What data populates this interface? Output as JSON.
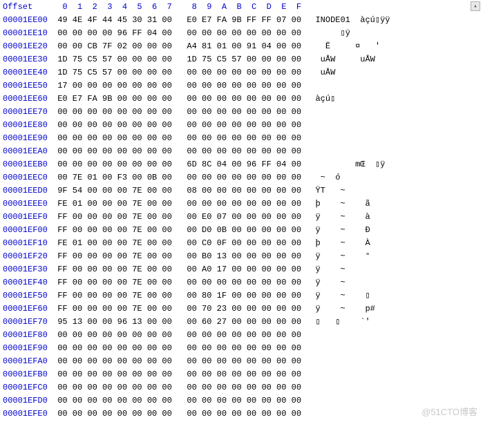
{
  "header": {
    "offset_label": "Offset",
    "columns": [
      "0",
      "1",
      "2",
      "3",
      "4",
      "5",
      "6",
      "7",
      "8",
      "9",
      "A",
      "B",
      "C",
      "D",
      "E",
      "F"
    ]
  },
  "rows": [
    {
      "offset": "00001EE00",
      "hex": [
        "49",
        "4E",
        "4F",
        "44",
        "45",
        "30",
        "31",
        "00",
        "E0",
        "E7",
        "FA",
        "9B",
        "FF",
        "FF",
        "07",
        "00"
      ],
      "ascii": "INODE01  àçú▯ÿÿ"
    },
    {
      "offset": "00001EE10",
      "hex": [
        "00",
        "00",
        "00",
        "00",
        "96",
        "FF",
        "04",
        "00",
        "00",
        "00",
        "00",
        "00",
        "00",
        "00",
        "00",
        "00"
      ],
      "ascii": "     ▯ÿ         "
    },
    {
      "offset": "00001EE20",
      "hex": [
        "00",
        "00",
        "CB",
        "7F",
        "02",
        "00",
        "00",
        "00",
        "A4",
        "81",
        "01",
        "00",
        "91",
        "04",
        "00",
        "00"
      ],
      "ascii": "  Ë     ¤   '   "
    },
    {
      "offset": "00001EE30",
      "hex": [
        "1D",
        "75",
        "C5",
        "57",
        "00",
        "00",
        "00",
        "00",
        "1D",
        "75",
        "C5",
        "57",
        "00",
        "00",
        "00",
        "00"
      ],
      "ascii": " uÅW     uÅW    "
    },
    {
      "offset": "00001EE40",
      "hex": [
        "1D",
        "75",
        "C5",
        "57",
        "00",
        "00",
        "00",
        "00",
        "00",
        "00",
        "00",
        "00",
        "00",
        "00",
        "00",
        "00"
      ],
      "ascii": " uÅW            "
    },
    {
      "offset": "00001EE50",
      "hex": [
        "17",
        "00",
        "00",
        "00",
        "00",
        "00",
        "00",
        "00",
        "00",
        "00",
        "00",
        "00",
        "00",
        "00",
        "00",
        "00"
      ],
      "ascii": "                "
    },
    {
      "offset": "00001EE60",
      "hex": [
        "E0",
        "E7",
        "FA",
        "9B",
        "00",
        "00",
        "00",
        "00",
        "00",
        "00",
        "00",
        "00",
        "00",
        "00",
        "00",
        "00"
      ],
      "ascii": "àçú▯            "
    },
    {
      "offset": "00001EE70",
      "hex": [
        "00",
        "00",
        "00",
        "00",
        "00",
        "00",
        "00",
        "00",
        "00",
        "00",
        "00",
        "00",
        "00",
        "00",
        "00",
        "00"
      ],
      "ascii": "                "
    },
    {
      "offset": "00001EE80",
      "hex": [
        "00",
        "00",
        "00",
        "00",
        "00",
        "00",
        "00",
        "00",
        "00",
        "00",
        "00",
        "00",
        "00",
        "00",
        "00",
        "00"
      ],
      "ascii": "                "
    },
    {
      "offset": "00001EE90",
      "hex": [
        "00",
        "00",
        "00",
        "00",
        "00",
        "00",
        "00",
        "00",
        "00",
        "00",
        "00",
        "00",
        "00",
        "00",
        "00",
        "00"
      ],
      "ascii": "                "
    },
    {
      "offset": "00001EEA0",
      "hex": [
        "00",
        "00",
        "00",
        "00",
        "00",
        "00",
        "00",
        "00",
        "00",
        "00",
        "00",
        "00",
        "00",
        "00",
        "00",
        "00"
      ],
      "ascii": "                "
    },
    {
      "offset": "00001EEB0",
      "hex": [
        "00",
        "00",
        "00",
        "00",
        "00",
        "00",
        "00",
        "00",
        "6D",
        "8C",
        "04",
        "00",
        "96",
        "FF",
        "04",
        "00"
      ],
      "ascii": "        mŒ  ▯ÿ  "
    },
    {
      "offset": "00001EEC0",
      "hex": [
        "00",
        "7E",
        "01",
        "00",
        "F3",
        "00",
        "0B",
        "00",
        "00",
        "00",
        "00",
        "00",
        "00",
        "00",
        "00",
        "00"
      ],
      "ascii": " ~  ó           "
    },
    {
      "offset": "00001EED0",
      "hex": [
        "9F",
        "54",
        "00",
        "00",
        "00",
        "7E",
        "00",
        "00",
        "08",
        "00",
        "00",
        "00",
        "00",
        "00",
        "00",
        "00"
      ],
      "ascii": "ŸT   ~          "
    },
    {
      "offset": "00001EEE0",
      "hex": [
        "FE",
        "01",
        "00",
        "00",
        "00",
        "7E",
        "00",
        "00",
        "00",
        "00",
        "00",
        "00",
        "00",
        "00",
        "00",
        "00"
      ],
      "ascii": "þ    ~    ã     "
    },
    {
      "offset": "00001EEF0",
      "hex": [
        "FF",
        "00",
        "00",
        "00",
        "00",
        "7E",
        "00",
        "00",
        "00",
        "E0",
        "07",
        "00",
        "00",
        "00",
        "00",
        "00"
      ],
      "ascii": "ÿ    ~    à     "
    },
    {
      "offset": "00001EF00",
      "hex": [
        "FF",
        "00",
        "00",
        "00",
        "00",
        "7E",
        "00",
        "00",
        "00",
        "D0",
        "0B",
        "00",
        "00",
        "00",
        "00",
        "00"
      ],
      "ascii": "ÿ    ~    Ð     "
    },
    {
      "offset": "00001EF10",
      "hex": [
        "FE",
        "01",
        "00",
        "00",
        "00",
        "7E",
        "00",
        "00",
        "00",
        "C0",
        "0F",
        "00",
        "00",
        "00",
        "00",
        "00"
      ],
      "ascii": "þ    ~    À     "
    },
    {
      "offset": "00001EF20",
      "hex": [
        "FF",
        "00",
        "00",
        "00",
        "00",
        "7E",
        "00",
        "00",
        "00",
        "B0",
        "13",
        "00",
        "00",
        "00",
        "00",
        "00"
      ],
      "ascii": "ÿ    ~    °     "
    },
    {
      "offset": "00001EF30",
      "hex": [
        "FF",
        "00",
        "00",
        "00",
        "00",
        "7E",
        "00",
        "00",
        "00",
        "A0",
        "17",
        "00",
        "00",
        "00",
        "00",
        "00"
      ],
      "ascii": "ÿ    ~          "
    },
    {
      "offset": "00001EF40",
      "hex": [
        "FF",
        "00",
        "00",
        "00",
        "00",
        "7E",
        "00",
        "00",
        "00",
        "00",
        "00",
        "00",
        "00",
        "00",
        "00",
        "00"
      ],
      "ascii": "ÿ    ~          "
    },
    {
      "offset": "00001EF50",
      "hex": [
        "FF",
        "00",
        "00",
        "00",
        "00",
        "7E",
        "00",
        "00",
        "00",
        "80",
        "1F",
        "00",
        "00",
        "00",
        "00",
        "00"
      ],
      "ascii": "ÿ    ~    ▯     "
    },
    {
      "offset": "00001EF60",
      "hex": [
        "FF",
        "00",
        "00",
        "00",
        "00",
        "7E",
        "00",
        "00",
        "00",
        "70",
        "23",
        "00",
        "00",
        "00",
        "00",
        "00"
      ],
      "ascii": "ÿ    ~    p#    "
    },
    {
      "offset": "00001EF70",
      "hex": [
        "95",
        "13",
        "00",
        "00",
        "96",
        "13",
        "00",
        "00",
        "00",
        "60",
        "27",
        "00",
        "00",
        "00",
        "00",
        "00"
      ],
      "ascii": "▯   ▯    `'     "
    },
    {
      "offset": "00001EF80",
      "hex": [
        "00",
        "00",
        "00",
        "00",
        "00",
        "00",
        "00",
        "00",
        "00",
        "00",
        "00",
        "00",
        "00",
        "00",
        "00",
        "00"
      ],
      "ascii": "                "
    },
    {
      "offset": "00001EF90",
      "hex": [
        "00",
        "00",
        "00",
        "00",
        "00",
        "00",
        "00",
        "00",
        "00",
        "00",
        "00",
        "00",
        "00",
        "00",
        "00",
        "00"
      ],
      "ascii": "                "
    },
    {
      "offset": "00001EFA0",
      "hex": [
        "00",
        "00",
        "00",
        "00",
        "00",
        "00",
        "00",
        "00",
        "00",
        "00",
        "00",
        "00",
        "00",
        "00",
        "00",
        "00"
      ],
      "ascii": "                "
    },
    {
      "offset": "00001EFB0",
      "hex": [
        "00",
        "00",
        "00",
        "00",
        "00",
        "00",
        "00",
        "00",
        "00",
        "00",
        "00",
        "00",
        "00",
        "00",
        "00",
        "00"
      ],
      "ascii": "                "
    },
    {
      "offset": "00001EFC0",
      "hex": [
        "00",
        "00",
        "00",
        "00",
        "00",
        "00",
        "00",
        "00",
        "00",
        "00",
        "00",
        "00",
        "00",
        "00",
        "00",
        "00"
      ],
      "ascii": "                "
    },
    {
      "offset": "00001EFD0",
      "hex": [
        "00",
        "00",
        "00",
        "00",
        "00",
        "00",
        "00",
        "00",
        "00",
        "00",
        "00",
        "00",
        "00",
        "00",
        "00",
        "00"
      ],
      "ascii": "                "
    },
    {
      "offset": "00001EFE0",
      "hex": [
        "00",
        "00",
        "00",
        "00",
        "00",
        "00",
        "00",
        "00",
        "00",
        "00",
        "00",
        "00",
        "00",
        "00",
        "00",
        "00"
      ],
      "ascii": "                "
    }
  ],
  "scroll_arrow": "▴",
  "watermark": "@51CTO博客"
}
